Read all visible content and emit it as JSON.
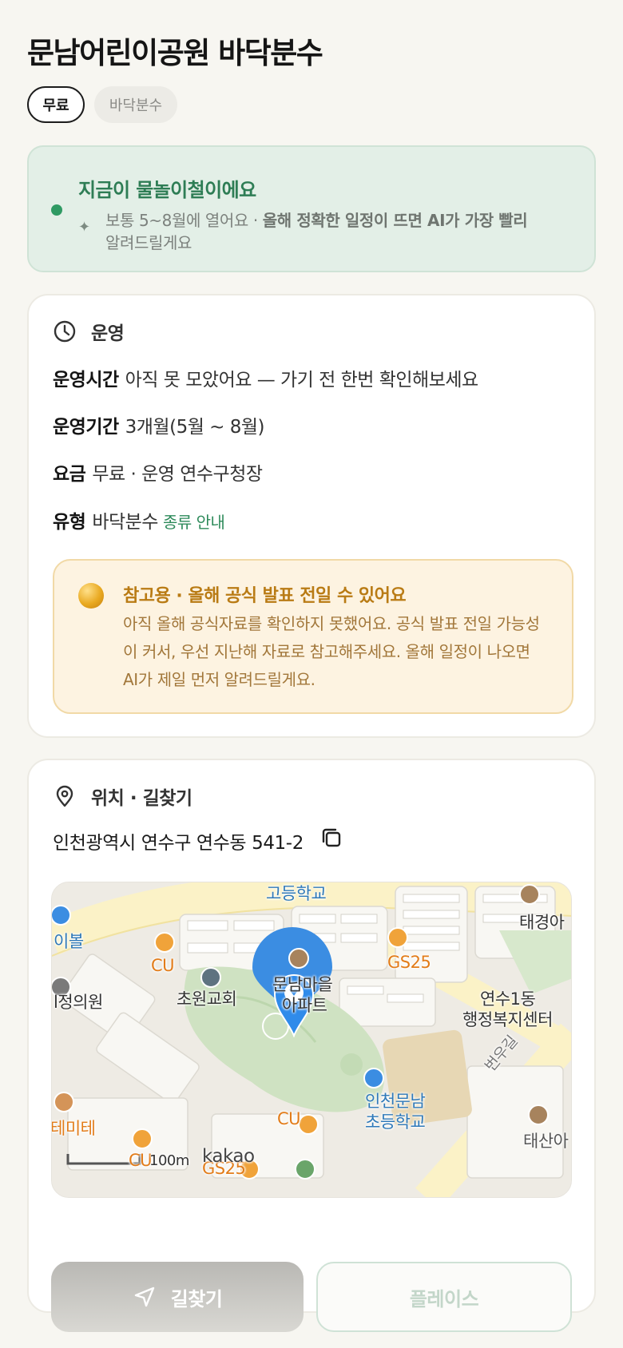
{
  "place": {
    "title": "문남어린이공원 바닥분수"
  },
  "chips": {
    "price": "무료",
    "type": "바닥분수"
  },
  "season": {
    "headline": "지금이 물놀이철이에요",
    "body_plain": "보통 5~8월에 열어요 · ",
    "body_bold": "올해 정확한 일정이 뜨면 AI가 가장 빨리",
    "body_tail": "알려드릴게요",
    "accent_color": "#2e7d55"
  },
  "operation": {
    "section_label": "운영",
    "hours_key": "운영시간",
    "hours_value": "아직 못 모았어요 — 가기 전 한번 확인해보세요",
    "period_key": "운영기간",
    "period_value": "3개월(5월 ~ 8월)",
    "fee_key": "요금",
    "fee_value": "무료 · 운영 연수구청장",
    "type_key": "유형",
    "type_value": "바닥분수",
    "type_link": "종류 안내"
  },
  "notice": {
    "title": "참고용 · 올해 공식 발표 전일 수 있어요",
    "text": "아직 올해 공식자료를 확인하지 못했어요. 공식 발표 전일 가능성이 커서, 우선 지난해 자료로 참고해주세요. 올해 일정이 나오면 AI가 제일 먼저 알려드릴게요.",
    "accent_color": "#b97b14"
  },
  "location": {
    "section_label": "위치 · 길찾기",
    "address": "인천광역시 연수구 연수동 541-2",
    "copy_icon": "copy-icon"
  },
  "map": {
    "labels": {
      "high_school": "고등학교",
      "taegyeong": "태경아",
      "ibol": "이볼",
      "cu1": "CU",
      "gs25_1": "GS25",
      "clinic": "l정의원",
      "church": "초원교회",
      "village1": "문남마을",
      "village2": "아파트",
      "yeonsu1": "연수1동",
      "yeonsu2": "행정복지센터",
      "beonwoo": "번우길",
      "school1": "인천문남",
      "school2": "초등학교",
      "cu2": "CU",
      "temite": "테미테",
      "taesan": "태산아",
      "cu3": "CU",
      "gs25_2": "GS25",
      "scale": "100m",
      "brand": "kakao"
    }
  },
  "actions": {
    "route_label": "길찾기",
    "place_label": "플레이스"
  }
}
